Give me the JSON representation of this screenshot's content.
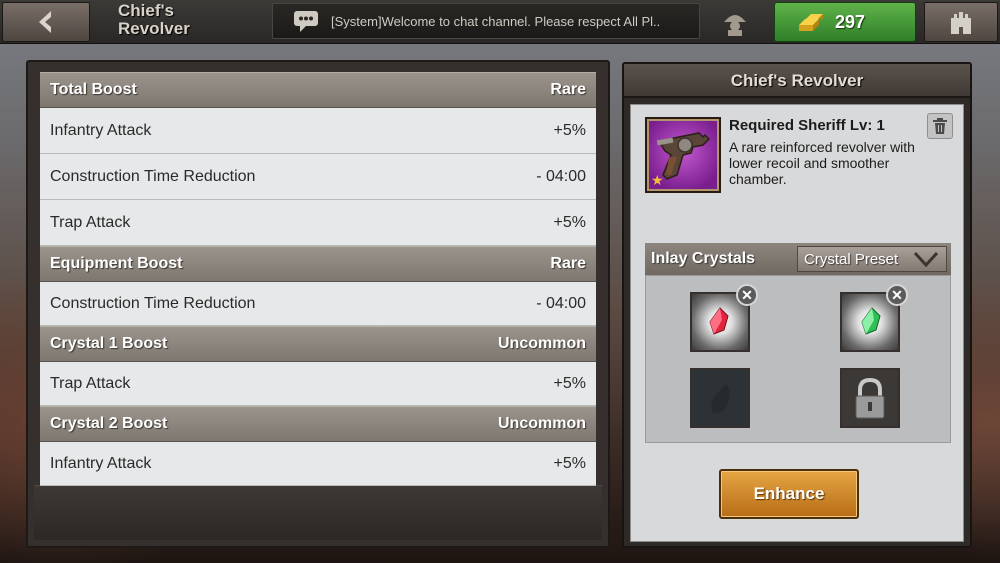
{
  "header": {
    "title": "Chief's Revolver",
    "chat_message": "[System]Welcome to chat channel. Please respect All Pl..",
    "gold": "297"
  },
  "boosts": {
    "total": {
      "label": "Total Boost",
      "rarity": "Rare",
      "rows": [
        {
          "name": "Infantry Attack",
          "value": "+5%"
        },
        {
          "name": "Construction Time Reduction",
          "value": "- 04:00"
        },
        {
          "name": "Trap Attack",
          "value": "+5%"
        }
      ]
    },
    "equipment": {
      "label": "Equipment Boost",
      "rarity": "Rare",
      "rows": [
        {
          "name": "Construction Time Reduction",
          "value": "- 04:00"
        }
      ]
    },
    "crystal1": {
      "label": "Crystal 1 Boost",
      "rarity": "Uncommon",
      "rows": [
        {
          "name": "Trap Attack",
          "value": "+5%"
        }
      ]
    },
    "crystal2": {
      "label": "Crystal 2 Boost",
      "rarity": "Uncommon",
      "rows": [
        {
          "name": "Infantry Attack",
          "value": "+5%"
        }
      ]
    }
  },
  "item": {
    "panel_title": "Chief's Revolver",
    "requirement": "Required Sheriff Lv: 1",
    "description": "A rare reinforced revolver with lower recoil and smoother chamber.",
    "icon": "revolver-icon"
  },
  "inlay": {
    "label": "Inlay Crystals",
    "preset_label": "Crystal Preset",
    "slots": [
      {
        "state": "filled",
        "crystal": "red-crystal-icon",
        "color": "#e3243e"
      },
      {
        "state": "filled",
        "crystal": "green-crystal-icon",
        "color": "#2fbf56"
      },
      {
        "state": "empty",
        "icon": "empty-slot-icon"
      },
      {
        "state": "locked",
        "icon": "lock-icon"
      }
    ]
  },
  "actions": {
    "enhance_label": "Enhance"
  },
  "colors": {
    "gold_button": "#3f9a35",
    "enhance_button": "#d08a2c",
    "item_rarity_bg": "#a43bb8"
  }
}
